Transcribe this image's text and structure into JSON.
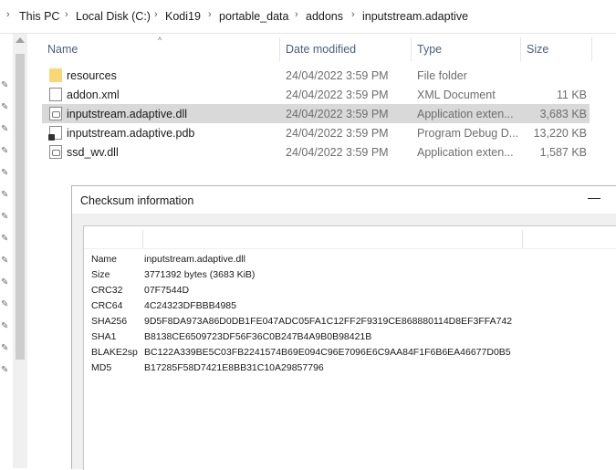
{
  "breadcrumb": [
    "This PC",
    "Local Disk (C:)",
    "Kodi19",
    "portable_data",
    "addons",
    "inputstream.adaptive"
  ],
  "columns": {
    "name": "Name",
    "date": "Date modified",
    "type": "Type",
    "size": "Size"
  },
  "files": [
    {
      "name": "resources",
      "date": "24/04/2022 3:59 PM",
      "type": "File folder",
      "size": "",
      "icon": "folder-icon"
    },
    {
      "name": "addon.xml",
      "date": "24/04/2022 3:59 PM",
      "type": "XML Document",
      "size": "11 KB",
      "icon": "document-icon"
    },
    {
      "name": "inputstream.adaptive.dll",
      "date": "24/04/2022 3:59 PM",
      "type": "Application exten...",
      "size": "3,683 KB",
      "icon": "dll-icon",
      "selected": true
    },
    {
      "name": "inputstream.adaptive.pdb",
      "date": "24/04/2022 3:59 PM",
      "type": "Program Debug D...",
      "size": "13,220 KB",
      "icon": "pdb-icon"
    },
    {
      "name": "ssd_wv.dll",
      "date": "24/04/2022 3:59 PM",
      "type": "Application exten...",
      "size": "1,587 KB",
      "icon": "dll-icon"
    }
  ],
  "dialog": {
    "title": "Checksum information",
    "minimize_glyph": "—",
    "entries": [
      {
        "key": "Name",
        "value": "inputstream.adaptive.dll"
      },
      {
        "key": "Size",
        "value": "3771392 bytes (3683 KiB)"
      },
      {
        "key": "CRC32",
        "value": "07F7544D"
      },
      {
        "key": "CRC64",
        "value": "4C24323DFBBB4985"
      },
      {
        "key": "SHA256",
        "value": "9D5F8DA973A86D0DB1FE047ADC05FA1C12FF2F9319CE868880114D8EF3FFA742"
      },
      {
        "key": "SHA1",
        "value": "B8138CE6509723DF56F36C0B247B4A9B0B98421B"
      },
      {
        "key": "BLAKE2sp",
        "value": "BC122A339BE5C03FB2241574B69E094C96E7096E6C9AA84F1F6B6EA46677D0B5"
      },
      {
        "key": "MD5",
        "value": "B17285F58D7421E8BB31C10A29857796"
      }
    ]
  }
}
